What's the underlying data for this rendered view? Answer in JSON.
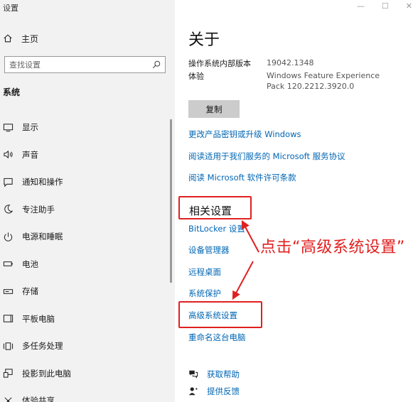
{
  "window": {
    "title": "设置"
  },
  "sidebar": {
    "home_label": "主页",
    "search_placeholder": "查找设置",
    "section": "系统",
    "items": [
      {
        "label": "显示",
        "icon": "monitor-icon"
      },
      {
        "label": "声音",
        "icon": "speaker-icon"
      },
      {
        "label": "通知和操作",
        "icon": "notification-icon"
      },
      {
        "label": "专注助手",
        "icon": "moon-icon"
      },
      {
        "label": "电源和睡眠",
        "icon": "power-icon"
      },
      {
        "label": "电池",
        "icon": "battery-icon"
      },
      {
        "label": "存储",
        "icon": "storage-icon"
      },
      {
        "label": "平板电脑",
        "icon": "tablet-icon"
      },
      {
        "label": "多任务处理",
        "icon": "multitask-icon"
      },
      {
        "label": "投影到此电脑",
        "icon": "project-icon"
      },
      {
        "label": "体验共享",
        "icon": "share-icon"
      }
    ]
  },
  "main": {
    "title": "关于",
    "info": [
      {
        "label": "操作系统内部版本",
        "value": "19042.1348"
      },
      {
        "label": "体验",
        "value": "Windows Feature Experience Pack 120.2212.3920.0"
      }
    ],
    "copy_button": "复制",
    "links": [
      "更改产品密钥或升级 Windows",
      "阅读适用于我们服务的 Microsoft 服务协议",
      "阅读 Microsoft 软件许可条款"
    ],
    "related_title": "相关设置",
    "related_links": [
      "BitLocker 设置",
      "设备管理器",
      "远程桌面",
      "系统保护",
      "高级系统设置",
      "重命名这台电脑"
    ],
    "help": [
      {
        "label": "获取帮助",
        "icon": "help-chat-icon"
      },
      {
        "label": "提供反馈",
        "icon": "feedback-icon"
      }
    ]
  },
  "annotation": {
    "text": "点击“高级系统设置”"
  },
  "colors": {
    "accent": "#0066b4",
    "annotation": "#e02020",
    "sidebar_bg": "#f2f2f2"
  }
}
